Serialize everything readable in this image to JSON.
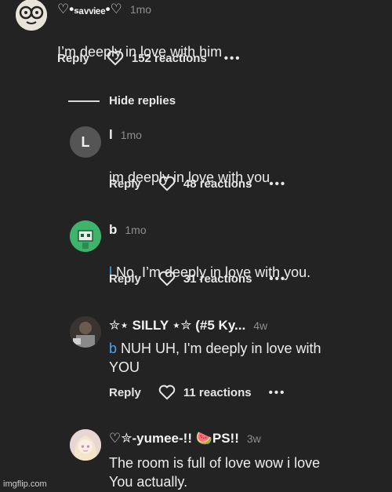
{
  "comments": [
    {
      "username": "♡•ₛₐᵥᵥᵢₑₑ•♡",
      "time": "1mo",
      "mention": "",
      "text": "I’m deeply in love with him",
      "reply_label": "Reply",
      "reactions": "152 reactions",
      "more": "•••",
      "avatar": {
        "kind": "glasses-face",
        "bg": "#e9e4da"
      }
    },
    {
      "username": "l",
      "time": "1mo",
      "mention": "",
      "text": "im deeply in love with you",
      "reply_label": "Reply",
      "reactions": "48 reactions",
      "more": "•••",
      "avatar": {
        "kind": "letter",
        "letter": "L",
        "bg": "#555555"
      }
    },
    {
      "username": "b",
      "time": "1mo",
      "mention": "l",
      "text": "No, I’m deeply in love with you.",
      "reply_label": "Reply",
      "reactions": "31 reactions",
      "more": "•••",
      "avatar": {
        "kind": "green-robot",
        "bg": "#3fb36a"
      }
    },
    {
      "username": "✮⋆ SILLY ⋆✮ (#5 Ky...",
      "time": "4w",
      "mention": "b",
      "text": "NUH UH, I'm deeply in love with\nYOU",
      "reply_label": "Reply",
      "reactions": "11 reactions",
      "more": "•••",
      "avatar": {
        "kind": "dark-photo",
        "bg": "#3a3430"
      }
    },
    {
      "username": "♡✮-yumee-!! 🍉PS!!",
      "time": "3w",
      "mention": "",
      "text": "The room is full of love wow i love\nYou actually.",
      "reply_label": "",
      "reactions": "",
      "more": "",
      "avatar": {
        "kind": "anime-girl",
        "bg": "#e8d6d2"
      }
    }
  ],
  "hide_replies": "Hide replies",
  "watermark": "imgflip.com",
  "colors": {
    "background": "#232323",
    "mention": "#4aa3f2",
    "muted": "#8e8e8e"
  },
  "icons": [
    "heart-icon",
    "more-icon"
  ]
}
